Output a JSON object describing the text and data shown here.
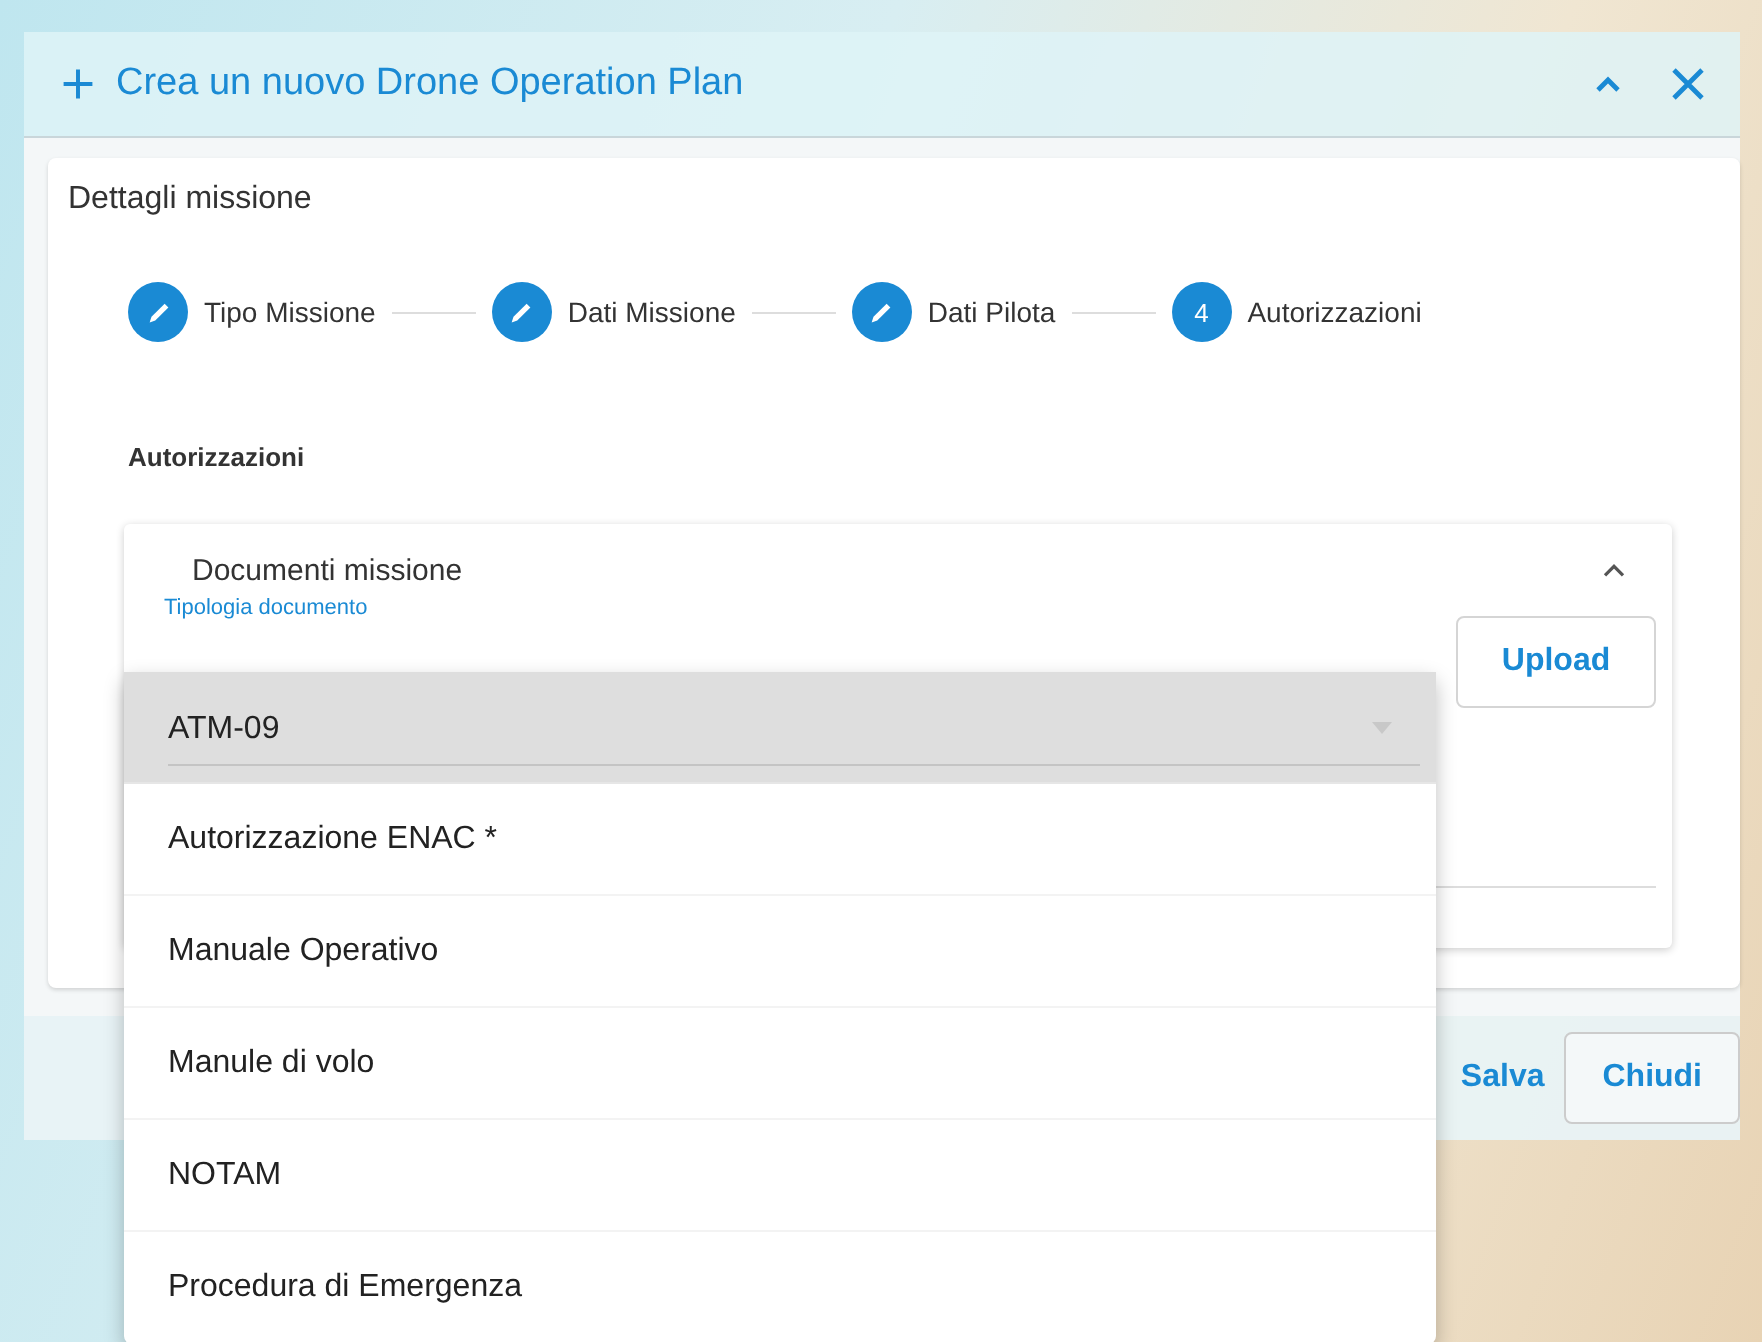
{
  "dialog": {
    "title": "Crea un nuovo Drone Operation Plan"
  },
  "card": {
    "title": "Dettagli missione"
  },
  "steps": [
    {
      "label": "Tipo Missione",
      "kind": "done"
    },
    {
      "label": "Dati Missione",
      "kind": "done"
    },
    {
      "label": "Dati Pilota",
      "kind": "done"
    },
    {
      "label": "Autorizzazioni",
      "kind": "current",
      "number": "4"
    }
  ],
  "section_title": "Autorizzazioni",
  "panel": {
    "title": "Documenti missione",
    "expanded": true,
    "field_label": "Tipologia documento",
    "upload_button": "Upload"
  },
  "footer": {
    "buttons": [
      {
        "label": "Salva",
        "kind": "text",
        "disabled": false
      },
      {
        "label": "Chiudi",
        "kind": "outlined",
        "disabled": false
      }
    ]
  },
  "dropdown": {
    "options": [
      {
        "label": "ATM-09",
        "selected": true
      },
      {
        "label": "Autorizzazione ENAC *",
        "selected": false
      },
      {
        "label": "Manuale Operativo",
        "selected": false
      },
      {
        "label": "Manule di volo",
        "selected": false
      },
      {
        "label": "NOTAM",
        "selected": false
      },
      {
        "label": "Procedura di Emergenza",
        "selected": false
      }
    ]
  }
}
